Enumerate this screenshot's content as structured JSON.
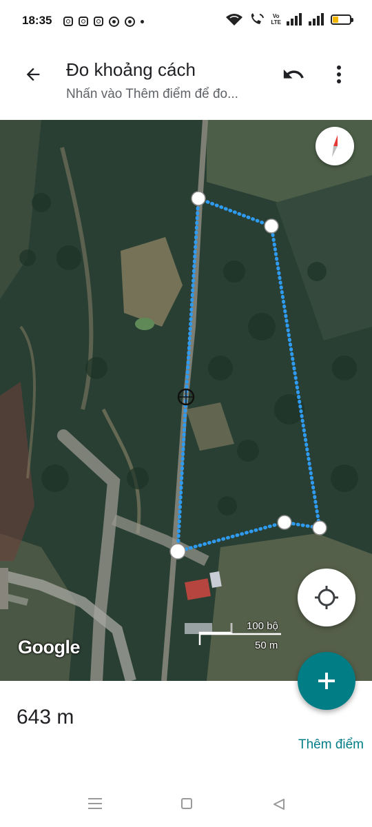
{
  "status_bar": {
    "time": "18:35",
    "notification_icons": [
      "instagram-icon",
      "instagram-icon",
      "instagram-icon",
      "chrome-icon",
      "chrome-icon",
      "dot-icon"
    ],
    "network_label_top": "Vo",
    "network_label_bottom": "LTE",
    "battery_level": 0.3,
    "battery_color": "#f2b705"
  },
  "header": {
    "title": "Đo khoảng cách",
    "subtitle": "Nhấn vào Thêm điểm để đo..."
  },
  "map": {
    "attribution": "Google",
    "scale_imperial": "100 bộ",
    "scale_metric": "50 m",
    "route_color": "#2f9bf0"
  },
  "bottom": {
    "distance": "643 m",
    "add_point_label": "Thêm điểm"
  },
  "colors": {
    "accent": "#017d86"
  }
}
